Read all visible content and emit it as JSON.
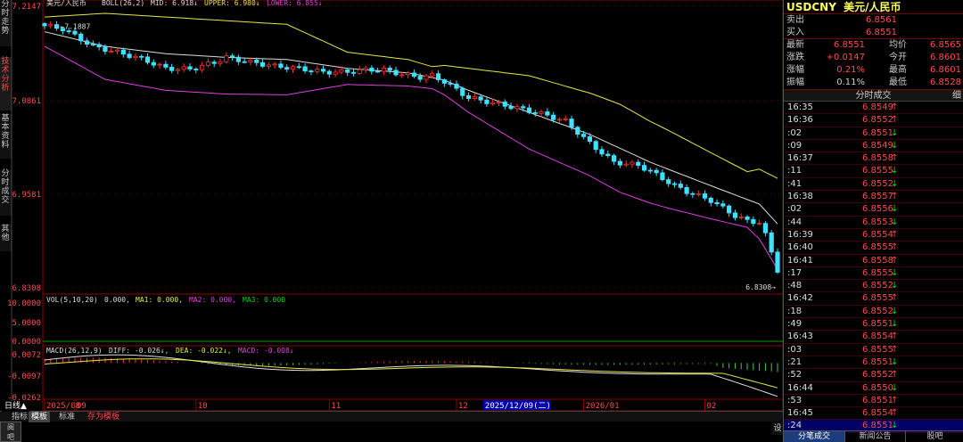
{
  "main_header": {
    "title": "美元/人民币",
    "series": [
      {
        "text": "BOLL(26,2)",
        "color": "#dddddd"
      },
      {
        "text": "MID: 6.918↓",
        "color": "#dddddd"
      },
      {
        "text": "UPPER: 6.980↓",
        "color": "#e6e64a"
      },
      {
        "text": "LOWER: 6.855↓",
        "color": "#e040e0"
      }
    ]
  },
  "price_axis": [
    "7.2147",
    "7.0861",
    "6.9581",
    "6.8308"
  ],
  "price_annotations": {
    "high": "7.1887",
    "low": "6.8308"
  },
  "vol_header": {
    "series": [
      {
        "text": "VOL(5,10,20)",
        "color": "#dddddd"
      },
      {
        "text": "0.000,",
        "color": "#dddddd"
      },
      {
        "text": "MA1: 0.000,",
        "color": "#e6e64a"
      },
      {
        "text": "MA2: 0.000,",
        "color": "#e040e0"
      },
      {
        "text": "MA3: 0.000",
        "color": "#00d000"
      }
    ]
  },
  "vol_axis": [
    "10.0000",
    "5.0000",
    "0.0000"
  ],
  "macd_header": {
    "series": [
      {
        "text": "MACD(26,12,9)",
        "color": "#dddddd"
      },
      {
        "text": "DIFF: -0.026↓,",
        "color": "#dddddd"
      },
      {
        "text": "DEA: -0.022↓,",
        "color": "#e6e64a"
      },
      {
        "text": "MACD: -0.008↓",
        "color": "#e040e0"
      }
    ]
  },
  "macd_axis": [
    "0.0072",
    "-0.0097",
    "-0.0262"
  ],
  "date_axis": [
    {
      "label": "2025/08",
      "pos": 0
    },
    {
      "label": "09",
      "pos": 5
    },
    {
      "label": "10",
      "pos": 25
    },
    {
      "label": "11",
      "pos": 47
    },
    {
      "label": "12",
      "pos": 68
    },
    {
      "label": "2026/01",
      "pos": 89
    },
    {
      "label": "02",
      "pos": 109
    }
  ],
  "cursor_date": {
    "label": "2025/12/09(二)",
    "pos": 73
  },
  "left_tabs": [
    "分时走势",
    "技术分析",
    "基本资料",
    "分时成交",
    "其他"
  ],
  "left_tab_active": 1,
  "bottom_tabs": {
    "period": "日线▲",
    "items": [
      "指标",
      "模板",
      "标准",
      "存为模板"
    ],
    "selected": 1,
    "settings": "设"
  },
  "left_stub": [
    "阅",
    "吧"
  ],
  "quote": {
    "symbol": "USDCNY",
    "name": "美元/人民币",
    "sell_label": "卖出",
    "sell": "6.8561",
    "buy_label": "买入",
    "buy": "6.8551",
    "rows": [
      {
        "l1": "最新",
        "v1": "6.8551",
        "c1": "red",
        "l2": "均价",
        "v2": "6.8565",
        "c2": "red"
      },
      {
        "l1": "涨跌",
        "v1": "+0.0147",
        "c1": "red",
        "l2": "今开",
        "v2": "6.8601",
        "c2": "red"
      },
      {
        "l1": "涨幅",
        "v1": "0.21%",
        "c1": "red",
        "l2": "最高",
        "v2": "6.8601",
        "c2": "red"
      },
      {
        "l1": "振幅",
        "v1": "0.11%",
        "c1": "lbl",
        "l2": "最低",
        "v2": "6.8528",
        "c2": "red"
      }
    ]
  },
  "trades": {
    "title": "分时成交",
    "corner": "细",
    "rows": [
      {
        "time": "16:35",
        "price": "6.8549",
        "dir": "↑",
        "c": "red"
      },
      {
        "time": "16:36",
        "price": "6.8552",
        "dir": "↑",
        "c": "red"
      },
      {
        "time": ":02",
        "price": "6.8551",
        "dir": "↓",
        "c": "grn"
      },
      {
        "time": ":09",
        "price": "6.8549",
        "dir": "↓",
        "c": "grn"
      },
      {
        "time": "16:37",
        "price": "6.8558",
        "dir": "↑",
        "c": "red"
      },
      {
        "time": ":11",
        "price": "6.8555",
        "dir": "↓",
        "c": "grn"
      },
      {
        "time": ":41",
        "price": "6.8552",
        "dir": "↓",
        "c": "grn"
      },
      {
        "time": "16:38",
        "price": "6.8557",
        "dir": "↑",
        "c": "red"
      },
      {
        "time": ":02",
        "price": "6.8556",
        "dir": "↓",
        "c": "grn"
      },
      {
        "time": ":44",
        "price": "6.8553",
        "dir": "↓",
        "c": "grn"
      },
      {
        "time": "16:39",
        "price": "6.8554",
        "dir": "↑",
        "c": "red"
      },
      {
        "time": "16:40",
        "price": "6.8555",
        "dir": "↑",
        "c": "red"
      },
      {
        "time": "16:41",
        "price": "6.8558",
        "dir": "↑",
        "c": "red"
      },
      {
        "time": ":17",
        "price": "6.8555",
        "dir": "↓",
        "c": "grn"
      },
      {
        "time": ":48",
        "price": "6.8552",
        "dir": "↓",
        "c": "grn"
      },
      {
        "time": "16:42",
        "price": "6.8555",
        "dir": "↑",
        "c": "red"
      },
      {
        "time": ":18",
        "price": "6.8552",
        "dir": "↓",
        "c": "grn"
      },
      {
        "time": ":49",
        "price": "6.8551",
        "dir": "↓",
        "c": "grn"
      },
      {
        "time": "16:43",
        "price": "6.8554",
        "dir": "↑",
        "c": "red"
      },
      {
        "time": ":03",
        "price": "6.8555",
        "dir": "↑",
        "c": "red"
      },
      {
        "time": ":21",
        "price": "6.8551",
        "dir": "↓",
        "c": "grn"
      },
      {
        "time": ":52",
        "price": "6.8552",
        "dir": "↑",
        "c": "red"
      },
      {
        "time": "16:44",
        "price": "6.8550",
        "dir": "↓",
        "c": "grn"
      },
      {
        "time": ":53",
        "price": "6.8551",
        "dir": "↑",
        "c": "red"
      },
      {
        "time": "16:45",
        "price": "6.8554",
        "dir": "↑",
        "c": "red"
      },
      {
        "time": ":24",
        "price": "6.8551",
        "dir": "↓",
        "c": "grn",
        "sel": true
      }
    ]
  },
  "panel_tabs": [
    "分笔成交",
    "新闻公告",
    "股吧"
  ],
  "panel_tab_selected": 0,
  "chart_data": {
    "type": "candlestick",
    "bars": 122,
    "price_range": [
      6.8308,
      7.2147
    ],
    "key_closes": [
      [
        0,
        7.188
      ],
      [
        3,
        7.184
      ],
      [
        8,
        7.16
      ],
      [
        12,
        7.152
      ],
      [
        16,
        7.143
      ],
      [
        20,
        7.13
      ],
      [
        24,
        7.129
      ],
      [
        28,
        7.138
      ],
      [
        30,
        7.145
      ],
      [
        33,
        7.14
      ],
      [
        38,
        7.133
      ],
      [
        42,
        7.13
      ],
      [
        46,
        7.125
      ],
      [
        50,
        7.125
      ],
      [
        53,
        7.128
      ],
      [
        56,
        7.128
      ],
      [
        59,
        7.122
      ],
      [
        62,
        7.118
      ],
      [
        64,
        7.12
      ],
      [
        66,
        7.112
      ],
      [
        70,
        7.09
      ],
      [
        74,
        7.083
      ],
      [
        78,
        7.076
      ],
      [
        82,
        7.068
      ],
      [
        86,
        7.058
      ],
      [
        90,
        7.028
      ],
      [
        94,
        7.002
      ],
      [
        98,
        6.998
      ],
      [
        100,
        6.99
      ],
      [
        104,
        6.97
      ],
      [
        106,
        6.962
      ],
      [
        110,
        6.95
      ],
      [
        114,
        6.929
      ],
      [
        116,
        6.922
      ],
      [
        118,
        6.92
      ],
      [
        119,
        6.903
      ],
      [
        121,
        6.855
      ]
    ],
    "mid_key": [
      [
        0,
        7.18
      ],
      [
        10,
        7.16
      ],
      [
        20,
        7.15
      ],
      [
        30,
        7.145
      ],
      [
        40,
        7.142
      ],
      [
        50,
        7.13
      ],
      [
        60,
        7.124
      ],
      [
        66,
        7.114
      ],
      [
        70,
        7.1
      ],
      [
        80,
        7.07
      ],
      [
        90,
        7.04
      ],
      [
        100,
        7.002
      ],
      [
        110,
        6.97
      ],
      [
        118,
        6.945
      ],
      [
        121,
        6.918
      ]
    ],
    "band_width_key": [
      [
        0,
        0.02
      ],
      [
        10,
        0.045
      ],
      [
        20,
        0.05
      ],
      [
        30,
        0.05
      ],
      [
        40,
        0.048
      ],
      [
        50,
        0.022
      ],
      [
        60,
        0.018
      ],
      [
        64,
        0.015
      ],
      [
        70,
        0.03
      ],
      [
        80,
        0.05
      ],
      [
        88,
        0.055
      ],
      [
        95,
        0.06
      ],
      [
        103,
        0.053
      ],
      [
        110,
        0.045
      ],
      [
        116,
        0.038
      ],
      [
        121,
        0.062
      ]
    ],
    "macd": {
      "range": [
        -0.0262,
        0.0072
      ],
      "diff_last": -0.026,
      "dea_last": -0.022,
      "macd_last": -0.008
    }
  }
}
